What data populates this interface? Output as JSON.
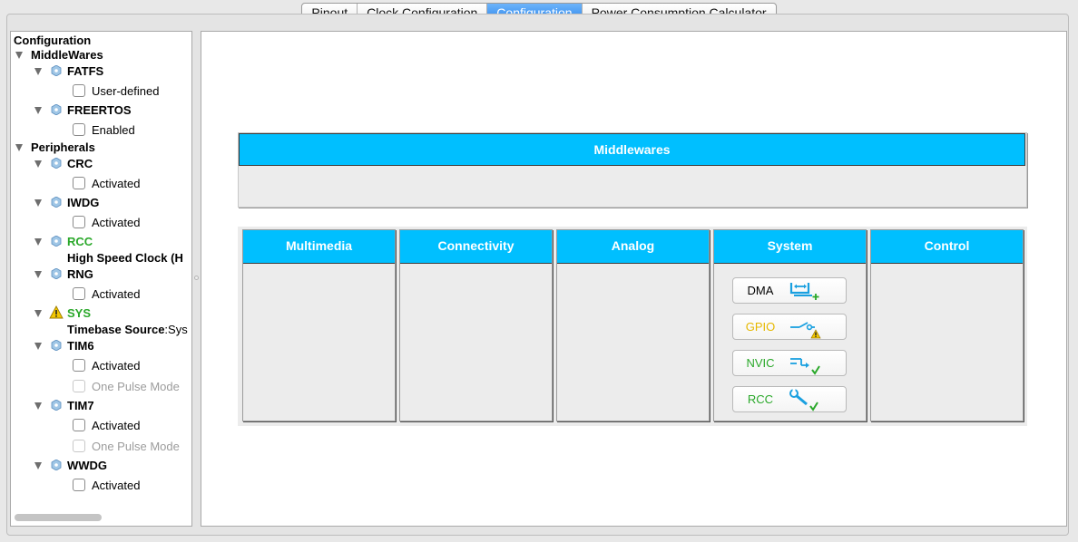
{
  "tabs": [
    {
      "label": "Pinout"
    },
    {
      "label": "Clock Configuration"
    },
    {
      "label": "Configuration"
    },
    {
      "label": "Power Consumption Calculator"
    }
  ],
  "active_tab": "Configuration",
  "tree": {
    "root": "Configuration",
    "middlewares": {
      "label": "MiddleWares",
      "fatfs": {
        "label": "FATFS",
        "option": "User-defined"
      },
      "freertos": {
        "label": "FREERTOS",
        "option": "Enabled"
      }
    },
    "peripherals": {
      "label": "Peripherals",
      "crc": {
        "label": "CRC",
        "option": "Activated"
      },
      "iwdg": {
        "label": "IWDG",
        "option": "Activated"
      },
      "rcc": {
        "label": "RCC",
        "detail": "High Speed Clock (H"
      },
      "rng": {
        "label": "RNG",
        "option": "Activated"
      },
      "sys": {
        "label": "SYS",
        "detail_key": "Timebase Source",
        "detail_sep": ":",
        "detail_val": "Sys"
      },
      "tim6": {
        "label": "TIM6",
        "option": "Activated",
        "option2": "One Pulse Mode"
      },
      "tim7": {
        "label": "TIM7",
        "option": "Activated",
        "option2": "One Pulse Mode"
      },
      "wwdg": {
        "label": "WWDG",
        "option": "Activated"
      }
    }
  },
  "main": {
    "middlewares_header": "Middlewares",
    "categories": [
      {
        "label": "Multimedia"
      },
      {
        "label": "Connectivity"
      },
      {
        "label": "Analog"
      },
      {
        "label": "System"
      },
      {
        "label": "Control"
      }
    ],
    "system_buttons": [
      {
        "label": "DMA",
        "status": "none",
        "icon": "dma-icon"
      },
      {
        "label": "GPIO",
        "status": "warning",
        "icon": "gpio-icon"
      },
      {
        "label": "NVIC",
        "status": "ok",
        "icon": "nvic-icon"
      },
      {
        "label": "RCC",
        "status": "ok",
        "icon": "rcc-wrench-icon"
      }
    ]
  },
  "colors": {
    "accent": "#00bfff",
    "tab_active": "#2f88ec",
    "ok_green": "#2aa82a",
    "warn_yellow": "#e6b800"
  }
}
